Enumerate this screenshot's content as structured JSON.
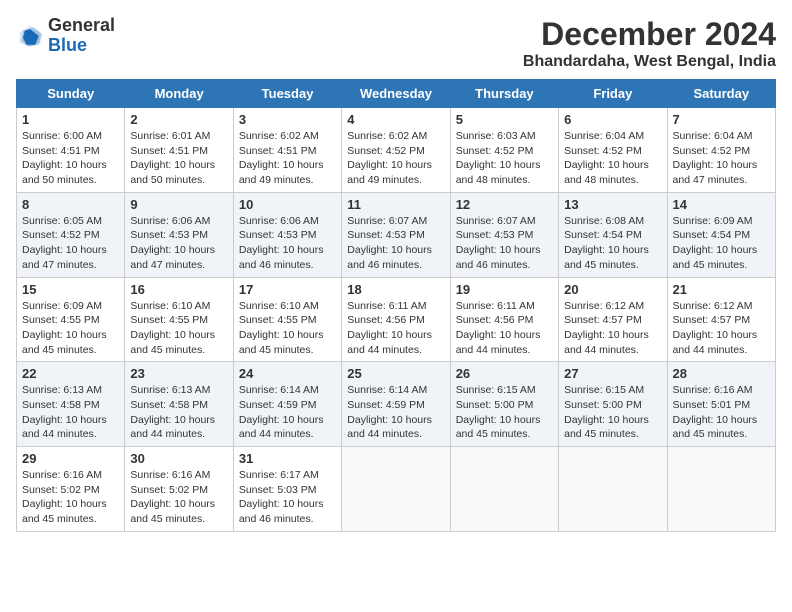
{
  "logo": {
    "general": "General",
    "blue": "Blue"
  },
  "title": "December 2024",
  "subtitle": "Bhandardaha, West Bengal, India",
  "days_header": [
    "Sunday",
    "Monday",
    "Tuesday",
    "Wednesday",
    "Thursday",
    "Friday",
    "Saturday"
  ],
  "weeks": [
    [
      {
        "num": "1",
        "sunrise": "6:00 AM",
        "sunset": "4:51 PM",
        "daylight": "10 hours and 50 minutes."
      },
      {
        "num": "2",
        "sunrise": "6:01 AM",
        "sunset": "4:51 PM",
        "daylight": "10 hours and 50 minutes."
      },
      {
        "num": "3",
        "sunrise": "6:02 AM",
        "sunset": "4:51 PM",
        "daylight": "10 hours and 49 minutes."
      },
      {
        "num": "4",
        "sunrise": "6:02 AM",
        "sunset": "4:52 PM",
        "daylight": "10 hours and 49 minutes."
      },
      {
        "num": "5",
        "sunrise": "6:03 AM",
        "sunset": "4:52 PM",
        "daylight": "10 hours and 48 minutes."
      },
      {
        "num": "6",
        "sunrise": "6:04 AM",
        "sunset": "4:52 PM",
        "daylight": "10 hours and 48 minutes."
      },
      {
        "num": "7",
        "sunrise": "6:04 AM",
        "sunset": "4:52 PM",
        "daylight": "10 hours and 47 minutes."
      }
    ],
    [
      {
        "num": "8",
        "sunrise": "6:05 AM",
        "sunset": "4:52 PM",
        "daylight": "10 hours and 47 minutes."
      },
      {
        "num": "9",
        "sunrise": "6:06 AM",
        "sunset": "4:53 PM",
        "daylight": "10 hours and 47 minutes."
      },
      {
        "num": "10",
        "sunrise": "6:06 AM",
        "sunset": "4:53 PM",
        "daylight": "10 hours and 46 minutes."
      },
      {
        "num": "11",
        "sunrise": "6:07 AM",
        "sunset": "4:53 PM",
        "daylight": "10 hours and 46 minutes."
      },
      {
        "num": "12",
        "sunrise": "6:07 AM",
        "sunset": "4:53 PM",
        "daylight": "10 hours and 46 minutes."
      },
      {
        "num": "13",
        "sunrise": "6:08 AM",
        "sunset": "4:54 PM",
        "daylight": "10 hours and 45 minutes."
      },
      {
        "num": "14",
        "sunrise": "6:09 AM",
        "sunset": "4:54 PM",
        "daylight": "10 hours and 45 minutes."
      }
    ],
    [
      {
        "num": "15",
        "sunrise": "6:09 AM",
        "sunset": "4:55 PM",
        "daylight": "10 hours and 45 minutes."
      },
      {
        "num": "16",
        "sunrise": "6:10 AM",
        "sunset": "4:55 PM",
        "daylight": "10 hours and 45 minutes."
      },
      {
        "num": "17",
        "sunrise": "6:10 AM",
        "sunset": "4:55 PM",
        "daylight": "10 hours and 45 minutes."
      },
      {
        "num": "18",
        "sunrise": "6:11 AM",
        "sunset": "4:56 PM",
        "daylight": "10 hours and 44 minutes."
      },
      {
        "num": "19",
        "sunrise": "6:11 AM",
        "sunset": "4:56 PM",
        "daylight": "10 hours and 44 minutes."
      },
      {
        "num": "20",
        "sunrise": "6:12 AM",
        "sunset": "4:57 PM",
        "daylight": "10 hours and 44 minutes."
      },
      {
        "num": "21",
        "sunrise": "6:12 AM",
        "sunset": "4:57 PM",
        "daylight": "10 hours and 44 minutes."
      }
    ],
    [
      {
        "num": "22",
        "sunrise": "6:13 AM",
        "sunset": "4:58 PM",
        "daylight": "10 hours and 44 minutes."
      },
      {
        "num": "23",
        "sunrise": "6:13 AM",
        "sunset": "4:58 PM",
        "daylight": "10 hours and 44 minutes."
      },
      {
        "num": "24",
        "sunrise": "6:14 AM",
        "sunset": "4:59 PM",
        "daylight": "10 hours and 44 minutes."
      },
      {
        "num": "25",
        "sunrise": "6:14 AM",
        "sunset": "4:59 PM",
        "daylight": "10 hours and 44 minutes."
      },
      {
        "num": "26",
        "sunrise": "6:15 AM",
        "sunset": "5:00 PM",
        "daylight": "10 hours and 45 minutes."
      },
      {
        "num": "27",
        "sunrise": "6:15 AM",
        "sunset": "5:00 PM",
        "daylight": "10 hours and 45 minutes."
      },
      {
        "num": "28",
        "sunrise": "6:16 AM",
        "sunset": "5:01 PM",
        "daylight": "10 hours and 45 minutes."
      }
    ],
    [
      {
        "num": "29",
        "sunrise": "6:16 AM",
        "sunset": "5:02 PM",
        "daylight": "10 hours and 45 minutes."
      },
      {
        "num": "30",
        "sunrise": "6:16 AM",
        "sunset": "5:02 PM",
        "daylight": "10 hours and 45 minutes."
      },
      {
        "num": "31",
        "sunrise": "6:17 AM",
        "sunset": "5:03 PM",
        "daylight": "10 hours and 46 minutes."
      },
      null,
      null,
      null,
      null
    ]
  ],
  "labels": {
    "sunrise": "Sunrise:",
    "sunset": "Sunset:",
    "daylight": "Daylight:"
  }
}
